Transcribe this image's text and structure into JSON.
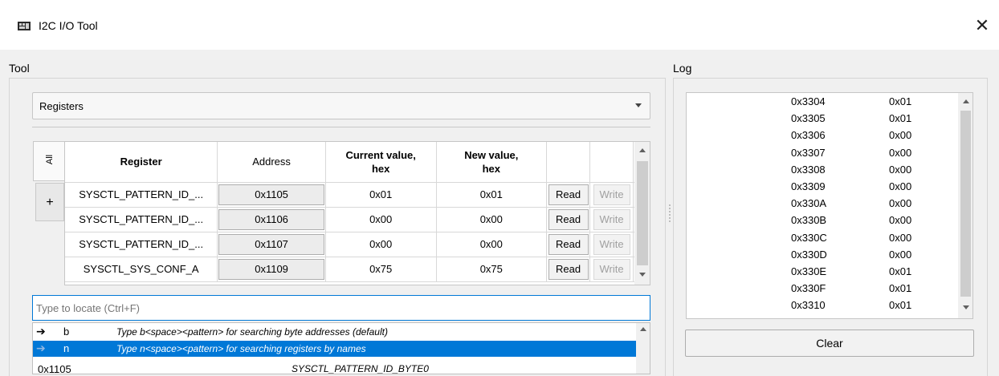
{
  "window": {
    "title": "I2C I/O Tool",
    "close_glyph": "✕"
  },
  "tool": {
    "label": "Tool",
    "view_select": "Registers",
    "side_tabs": {
      "all": "All",
      "add": "+"
    },
    "table": {
      "headers": {
        "register": "Register",
        "address": "Address",
        "current": "Current value,\nhex",
        "new": "New value,\nhex"
      },
      "rows": [
        {
          "register": "SYSCTL_PATTERN_ID_...",
          "address": "0x1105",
          "current": "0x01",
          "new": "0x01",
          "read": "Read",
          "write": "Write"
        },
        {
          "register": "SYSCTL_PATTERN_ID_...",
          "address": "0x1106",
          "current": "0x00",
          "new": "0x00",
          "read": "Read",
          "write": "Write"
        },
        {
          "register": "SYSCTL_PATTERN_ID_...",
          "address": "0x1107",
          "current": "0x00",
          "new": "0x00",
          "read": "Read",
          "write": "Write"
        },
        {
          "register": "SYSCTL_SYS_CONF_A",
          "address": "0x1109",
          "current": "0x75",
          "new": "0x75",
          "read": "Read",
          "write": "Write"
        }
      ]
    },
    "locate": {
      "placeholder": "Type to locate (Ctrl+F)",
      "hints": [
        {
          "key": "b",
          "text": "Type b<space><pattern> for searching byte addresses (default)"
        },
        {
          "key": "n",
          "text": "Type n<space><pattern> for searching registers by names"
        }
      ],
      "result": {
        "address": "0x1105",
        "name": "SYSCTL_PATTERN_ID_BYTE0"
      }
    }
  },
  "log": {
    "label": "Log",
    "entries": [
      {
        "addr": "0x3304",
        "val": "0x01"
      },
      {
        "addr": "0x3305",
        "val": "0x01"
      },
      {
        "addr": "0x3306",
        "val": "0x00"
      },
      {
        "addr": "0x3307",
        "val": "0x00"
      },
      {
        "addr": "0x3308",
        "val": "0x00"
      },
      {
        "addr": "0x3309",
        "val": "0x00"
      },
      {
        "addr": "0x330A",
        "val": "0x00"
      },
      {
        "addr": "0x330B",
        "val": "0x00"
      },
      {
        "addr": "0x330C",
        "val": "0x00"
      },
      {
        "addr": "0x330D",
        "val": "0x00"
      },
      {
        "addr": "0x330E",
        "val": "0x01"
      },
      {
        "addr": "0x330F",
        "val": "0x01"
      },
      {
        "addr": "0x3310",
        "val": "0x01"
      }
    ],
    "clear_label": "Clear"
  },
  "colors": {
    "selection": "#0078d7",
    "focus_border": "#0078d7"
  }
}
